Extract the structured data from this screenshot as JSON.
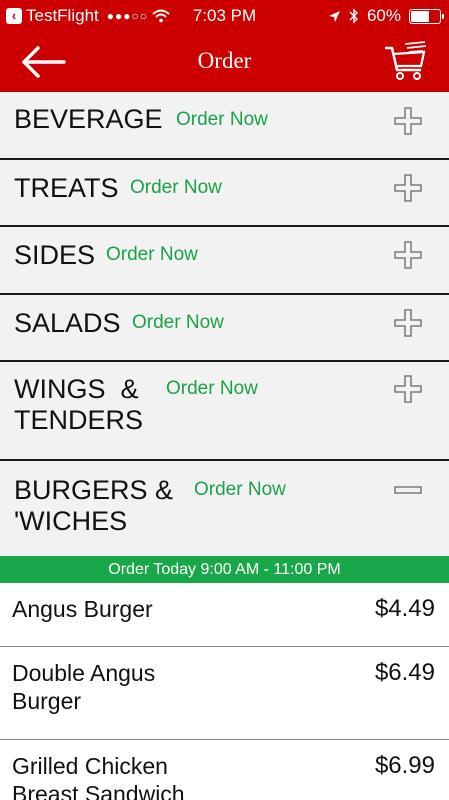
{
  "status_bar": {
    "carrier": "TestFlight",
    "signal": "●●●○○",
    "time": "7:03 PM",
    "battery": "60%",
    "battery_level": 0.6
  },
  "nav": {
    "title": "Order",
    "back_icon": "arrow-left-icon",
    "cart_icon": "cart-icon"
  },
  "colors": {
    "brand_red": "#cc0000",
    "accent_green": "#1aa34a",
    "hours_green": "#18a84a"
  },
  "categories": [
    {
      "name": "BEVERAGE",
      "action": "Order Now",
      "expanded": false
    },
    {
      "name": "TREATS",
      "action": "Order Now",
      "expanded": false
    },
    {
      "name": "SIDES",
      "action": "Order Now",
      "expanded": false
    },
    {
      "name": "SALADS",
      "action": "Order Now",
      "expanded": false
    },
    {
      "name_line1": "WINGS  &",
      "name_line2": "TENDERS",
      "action": "Order Now",
      "expanded": false
    },
    {
      "name_line1": "BURGERS &",
      "name_line2": "'WICHES",
      "action": "Order Now",
      "expanded": true
    }
  ],
  "hours_banner": "Order Today 9:00 AM - 11:00 PM",
  "menu_items": [
    {
      "name": "Angus Burger",
      "price": "$4.49"
    },
    {
      "name_line1": "Double Angus",
      "name_line2": "Burger",
      "price": "$6.49"
    },
    {
      "name_line1": "Grilled Chicken",
      "name_line2": "Breast Sandwich",
      "price": "$6.99"
    }
  ]
}
